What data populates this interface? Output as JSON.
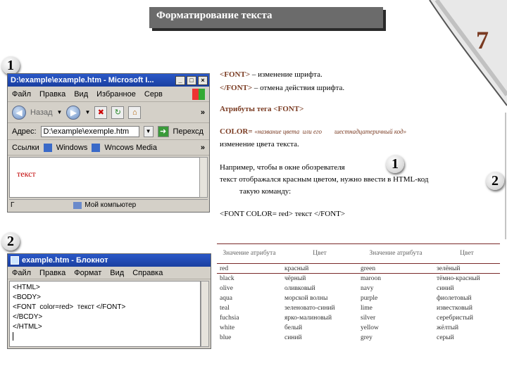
{
  "slide": {
    "title": "Форматирование текста",
    "number": "7"
  },
  "markers": {
    "m1_left": "1",
    "m2_left": "2",
    "m1_center": "1",
    "m2_right": "2"
  },
  "browser": {
    "title": "D:\\example\\example.htm - Microsoft I...",
    "menu": [
      "Файл",
      "Правка",
      "Вид",
      "Избранное",
      "Серв"
    ],
    "chevron": "»",
    "back_label": "Назад",
    "address_label": "Адрес:",
    "address_value": "D:\\example\\exemple.htm",
    "go_label": "Перехсд",
    "links_label": "Ссылки",
    "link1": "Windows",
    "link2": "Wncows Media",
    "content_text": "текст",
    "status_left": "Г",
    "status_right": "Мой компьютер"
  },
  "notepad": {
    "title": "example.htm - Блокнот",
    "menu": [
      "Файл",
      "Правка",
      "Формат",
      "Вид",
      "Справка"
    ],
    "lines": [
      "<HTML>",
      "<BODY>",
      "<FONT  color=red>  текст </FONT>",
      "</BCDY>",
      "</HTML>"
    ]
  },
  "text": {
    "line1_tag": "<FONT>",
    "line1_rest": " – изменение шрифта.",
    "line2_tag": "</FONT>",
    "line2_rest": " – отмена действия шрифта.",
    "attr_heading": "Атрибуты тега <FONT>",
    "color_label": "COLOR=",
    "color_hint": "«название цвета  или его        шестнадцатеричный код»",
    "color_desc": "изменение цвета текста.",
    "example_1": "Например, чтобы в окне обозревателя",
    "example_2": "текст отображался красным цветом, нужно ввести в HTML-код",
    "example_3": "такую команду:",
    "example_code": "<FONT  COLOR= red>  текст </FONT>"
  },
  "table": {
    "headers": [
      "Значение атрибута",
      "Цвет",
      "Значение атрибута",
      "Цвет"
    ],
    "rows": [
      [
        "red",
        "красный",
        "green",
        "зелёный"
      ],
      [
        "black",
        "чёрный",
        "maroon",
        "тёмно-красный"
      ],
      [
        "olive",
        "оливковый",
        "navy",
        "синий"
      ],
      [
        "aqua",
        "морской волны",
        "purple",
        "фиолетовый"
      ],
      [
        "teal",
        "зеленовато-синий",
        "lime",
        "известковый"
      ],
      [
        "fuchsia",
        "ярко-малиновый",
        "silver",
        "серебристый"
      ],
      [
        "white",
        "белый",
        "yellow",
        "жёлтый"
      ],
      [
        "blue",
        "синий",
        "grey",
        "серый"
      ]
    ]
  },
  "colors": {
    "accent": "#7a3b22",
    "titlebar": "#1a3fa0",
    "table_rule": "#7a2a2a",
    "red_text": "#c00000"
  }
}
